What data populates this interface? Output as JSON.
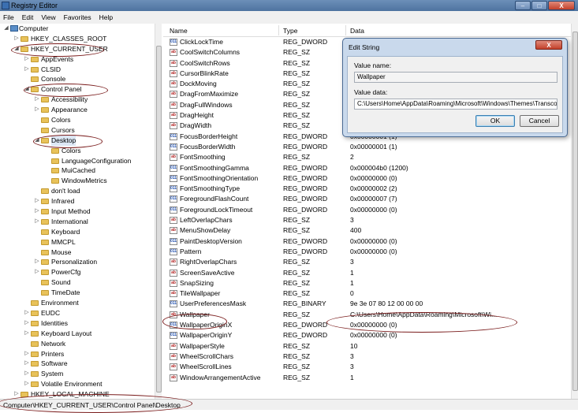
{
  "window": {
    "title": "Registry Editor",
    "btn_min": "–",
    "btn_max": "□",
    "btn_close": "X"
  },
  "menu": [
    "File",
    "Edit",
    "View",
    "Favorites",
    "Help"
  ],
  "tree": [
    {
      "label": "Computer",
      "level": 0,
      "expander": "◢"
    },
    {
      "label": "HKEY_CLASSES_ROOT",
      "level": 1,
      "expander": "▷"
    },
    {
      "label": "HKEY_CURRENT_USER",
      "level": 1,
      "expander": "◢"
    },
    {
      "label": "AppEvents",
      "level": 2,
      "expander": "▷"
    },
    {
      "label": "CLSID",
      "level": 2,
      "expander": "▷"
    },
    {
      "label": "Console",
      "level": 2,
      "expander": ""
    },
    {
      "label": "Control Panel",
      "level": 2,
      "expander": "◢"
    },
    {
      "label": "Accessibility",
      "level": 3,
      "expander": "▷"
    },
    {
      "label": "Appearance",
      "level": 3,
      "expander": "▷"
    },
    {
      "label": "Colors",
      "level": 3,
      "expander": ""
    },
    {
      "label": "Cursors",
      "level": 3,
      "expander": ""
    },
    {
      "label": "Desktop",
      "level": 3,
      "expander": "◢",
      "selected": true
    },
    {
      "label": "Colors",
      "level": 4,
      "expander": ""
    },
    {
      "label": "LanguageConfiguration",
      "level": 4,
      "expander": ""
    },
    {
      "label": "MuiCached",
      "level": 4,
      "expander": ""
    },
    {
      "label": "WindowMetrics",
      "level": 4,
      "expander": ""
    },
    {
      "label": "don't load",
      "level": 3,
      "expander": ""
    },
    {
      "label": "Infrared",
      "level": 3,
      "expander": "▷"
    },
    {
      "label": "Input Method",
      "level": 3,
      "expander": "▷"
    },
    {
      "label": "International",
      "level": 3,
      "expander": "▷"
    },
    {
      "label": "Keyboard",
      "level": 3,
      "expander": ""
    },
    {
      "label": "MMCPL",
      "level": 3,
      "expander": ""
    },
    {
      "label": "Mouse",
      "level": 3,
      "expander": ""
    },
    {
      "label": "Personalization",
      "level": 3,
      "expander": "▷"
    },
    {
      "label": "PowerCfg",
      "level": 3,
      "expander": "▷"
    },
    {
      "label": "Sound",
      "level": 3,
      "expander": ""
    },
    {
      "label": "TimeDate",
      "level": 3,
      "expander": ""
    },
    {
      "label": "Environment",
      "level": 2,
      "expander": ""
    },
    {
      "label": "EUDC",
      "level": 2,
      "expander": "▷"
    },
    {
      "label": "Identities",
      "level": 2,
      "expander": "▷"
    },
    {
      "label": "Keyboard Layout",
      "level": 2,
      "expander": "▷"
    },
    {
      "label": "Network",
      "level": 2,
      "expander": ""
    },
    {
      "label": "Printers",
      "level": 2,
      "expander": "▷"
    },
    {
      "label": "Software",
      "level": 2,
      "expander": "▷"
    },
    {
      "label": "System",
      "level": 2,
      "expander": "▷"
    },
    {
      "label": "Volatile Environment",
      "level": 2,
      "expander": "▷"
    },
    {
      "label": "HKEY_LOCAL_MACHINE",
      "level": 1,
      "expander": "▷"
    }
  ],
  "columns": {
    "name": "Name",
    "type": "Type",
    "data": "Data"
  },
  "values": [
    {
      "name": "ClickLockTime",
      "type": "REG_DWORD",
      "data": "",
      "icon": "bin"
    },
    {
      "name": "CoolSwitchColumns",
      "type": "REG_SZ",
      "data": "",
      "icon": "sz"
    },
    {
      "name": "CoolSwitchRows",
      "type": "REG_SZ",
      "data": "",
      "icon": "sz"
    },
    {
      "name": "CursorBlinkRate",
      "type": "REG_SZ",
      "data": "",
      "icon": "sz"
    },
    {
      "name": "DockMoving",
      "type": "REG_SZ",
      "data": "",
      "icon": "sz"
    },
    {
      "name": "DragFromMaximize",
      "type": "REG_SZ",
      "data": "",
      "icon": "sz"
    },
    {
      "name": "DragFullWindows",
      "type": "REG_SZ",
      "data": "",
      "icon": "sz"
    },
    {
      "name": "DragHeight",
      "type": "REG_SZ",
      "data": "",
      "icon": "sz"
    },
    {
      "name": "DragWidth",
      "type": "REG_SZ",
      "data": "",
      "icon": "sz"
    },
    {
      "name": "FocusBorderHeight",
      "type": "REG_DWORD",
      "data": "0x00000001 (1)",
      "icon": "bin"
    },
    {
      "name": "FocusBorderWidth",
      "type": "REG_DWORD",
      "data": "0x00000001 (1)",
      "icon": "bin"
    },
    {
      "name": "FontSmoothing",
      "type": "REG_SZ",
      "data": "2",
      "icon": "sz"
    },
    {
      "name": "FontSmoothingGamma",
      "type": "REG_DWORD",
      "data": "0x000004b0 (1200)",
      "icon": "bin"
    },
    {
      "name": "FontSmoothingOrientation",
      "type": "REG_DWORD",
      "data": "0x00000000 (0)",
      "icon": "bin"
    },
    {
      "name": "FontSmoothingType",
      "type": "REG_DWORD",
      "data": "0x00000002 (2)",
      "icon": "bin"
    },
    {
      "name": "ForegroundFlashCount",
      "type": "REG_DWORD",
      "data": "0x00000007 (7)",
      "icon": "bin"
    },
    {
      "name": "ForegroundLockTimeout",
      "type": "REG_DWORD",
      "data": "0x00000000 (0)",
      "icon": "bin"
    },
    {
      "name": "LeftOverlapChars",
      "type": "REG_SZ",
      "data": "3",
      "icon": "sz"
    },
    {
      "name": "MenuShowDelay",
      "type": "REG_SZ",
      "data": "400",
      "icon": "sz"
    },
    {
      "name": "PaintDesktopVersion",
      "type": "REG_DWORD",
      "data": "0x00000000 (0)",
      "icon": "bin"
    },
    {
      "name": "Pattern",
      "type": "REG_DWORD",
      "data": "0x00000000 (0)",
      "icon": "bin"
    },
    {
      "name": "RightOverlapChars",
      "type": "REG_SZ",
      "data": "3",
      "icon": "sz"
    },
    {
      "name": "ScreenSaveActive",
      "type": "REG_SZ",
      "data": "1",
      "icon": "sz"
    },
    {
      "name": "SnapSizing",
      "type": "REG_SZ",
      "data": "1",
      "icon": "sz"
    },
    {
      "name": "TileWallpaper",
      "type": "REG_SZ",
      "data": "0",
      "icon": "sz"
    },
    {
      "name": "UserPreferencesMask",
      "type": "REG_BINARY",
      "data": "9e 3e 07 80 12 00 00 00",
      "icon": "bin"
    },
    {
      "name": "Wallpaper",
      "type": "REG_SZ",
      "data": "C:\\Users\\Home\\AppData\\Roaming\\Microsoft\\Wi...",
      "icon": "sz"
    },
    {
      "name": "WallpaperOriginX",
      "type": "REG_DWORD",
      "data": "0x00000000 (0)",
      "icon": "bin"
    },
    {
      "name": "WallpaperOriginY",
      "type": "REG_DWORD",
      "data": "0x00000000 (0)",
      "icon": "bin"
    },
    {
      "name": "WallpaperStyle",
      "type": "REG_SZ",
      "data": "10",
      "icon": "sz"
    },
    {
      "name": "WheelScrollChars",
      "type": "REG_SZ",
      "data": "3",
      "icon": "sz"
    },
    {
      "name": "WheelScrollLines",
      "type": "REG_SZ",
      "data": "3",
      "icon": "sz"
    },
    {
      "name": "WindowArrangementActive",
      "type": "REG_SZ",
      "data": "1",
      "icon": "sz"
    }
  ],
  "dialog": {
    "title": "Edit String",
    "close": "X",
    "name_label": "Value name:",
    "name_value": "Wallpaper",
    "data_label": "Value data:",
    "data_value": "C:\\Users\\Home\\AppData\\Roaming\\Microsoft\\Windows\\Themes\\Transcoc",
    "ok": "OK",
    "cancel": "Cancel"
  },
  "status": {
    "path": "Computer\\HKEY_CURRENT_USER\\Control Panel\\Desktop"
  },
  "colors": {
    "titlebar": "#4e73a0",
    "annotation": "#7a1c1c",
    "folder": "#e8c25a"
  }
}
